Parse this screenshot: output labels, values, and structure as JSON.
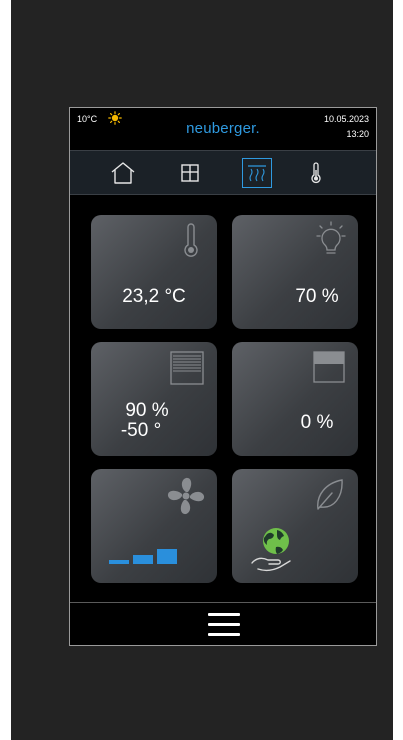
{
  "status_bar": {
    "outdoor_temperature": "10°C",
    "weather_icon": "sun-icon",
    "brand": "neuberger.",
    "date": "10.05.2023",
    "time": "13:20"
  },
  "nav": {
    "items": [
      {
        "name": "home",
        "icon": "house-icon",
        "active": false
      },
      {
        "name": "window",
        "icon": "window-icon",
        "active": false
      },
      {
        "name": "heating",
        "icon": "heating-icon",
        "active": true
      },
      {
        "name": "thermometer",
        "icon": "thermometer-icon",
        "active": false
      }
    ]
  },
  "tiles": {
    "temperature": {
      "icon": "thermometer-icon",
      "value": "23,2 °C"
    },
    "light": {
      "icon": "lightbulb-icon",
      "value": "70 %"
    },
    "blinds": {
      "icon": "blinds-icon",
      "value_line1": "90 %",
      "value_line2": "-50 °"
    },
    "shutter": {
      "icon": "shutter-icon",
      "value": "0 %"
    },
    "fan": {
      "icon": "fan-icon",
      "level_bars": 3,
      "level_bars_total": 3
    },
    "eco": {
      "icon": "leaf-icon",
      "badge_icon": "globe-hand-icon"
    }
  },
  "footer": {
    "menu_icon": "hamburger-menu-icon"
  },
  "colors": {
    "accent_blue": "#2f9ae0",
    "level_blue": "#2a8fdc",
    "screen_bg": "#000000",
    "device_frame": "#232323"
  }
}
